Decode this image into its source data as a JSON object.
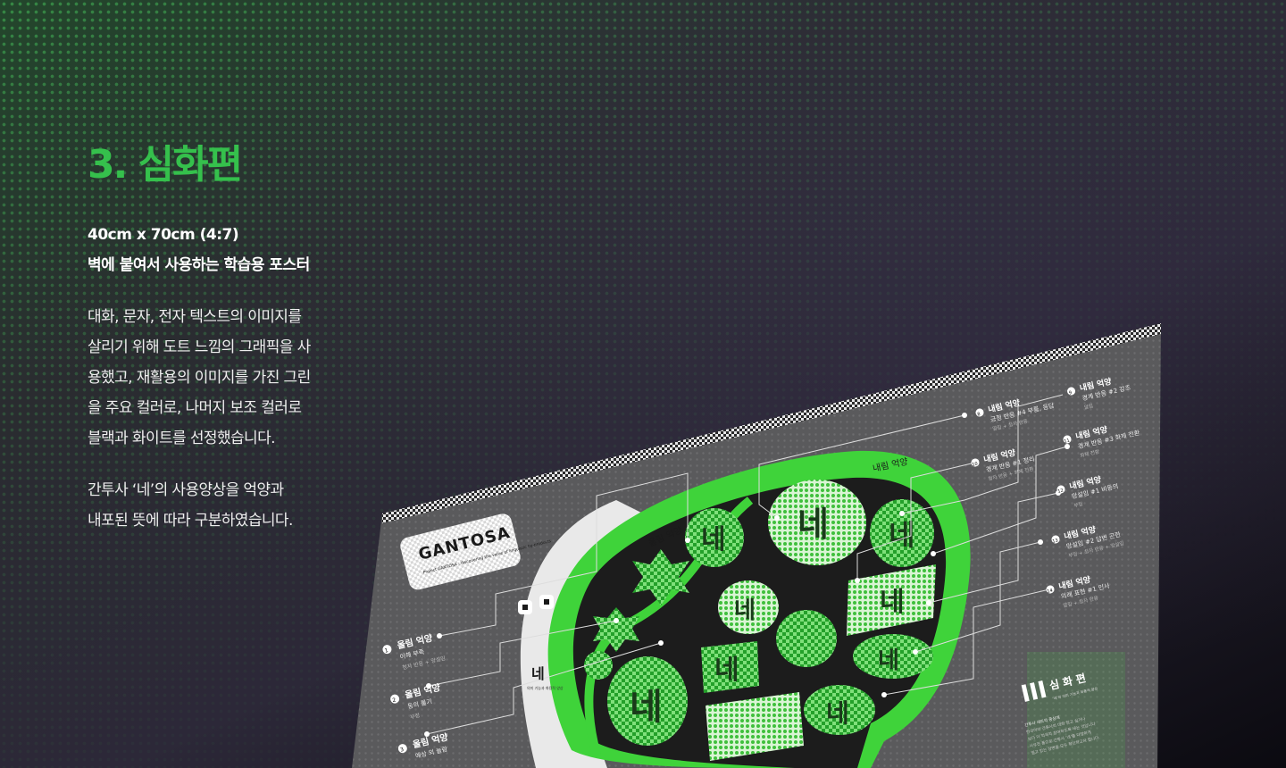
{
  "colors": {
    "accent": "#35c04c",
    "poster_bg": "#5a5a5c",
    "bubble": "#3fd33a",
    "text": "#ffffff"
  },
  "section": {
    "title": "3. 심화편"
  },
  "specs": {
    "size": "40cm x 70cm (4:7)",
    "purpose": "벽에 붙여서 사용하는 학습용 포스터"
  },
  "description": {
    "p1": [
      "대화, 문자, 전자 텍스트의 이미지를",
      "살리기 위해 도트 느낌의 그래픽을 사",
      "용했고, 재활용의 이미지를 가진 그린",
      "을 주요 컬러로, 나머지 보조 컬러로",
      "블랙과 화이트를 선정했습니다."
    ],
    "p2": [
      "간투사 ‘네’의 사용양상을 억양과",
      "내포된 뜻에 따라 구분하였습니다."
    ]
  },
  "poster": {
    "logo": "GANTOSA",
    "logo_sub": "Project GANTOSA : discovering the value of linguistic by-products",
    "center_char": "네",
    "center_sub": "의미 기능과 화용적 양상",
    "rising_label": "올림 억양",
    "falling_label": "내림 억양",
    "bubble_char": "네",
    "volume_mark": "III",
    "volume_title": "심 화 편",
    "volume_tags": "‘네’의 의미 기능과 화용적 양상",
    "left_items": [
      {
        "num": "1",
        "title": "올림 억양",
        "desc": "이해 부족",
        "sub": "청자 반응 + 망설임"
      },
      {
        "num": "2",
        "title": "올림 억양",
        "desc": "동의 물기",
        "sub": "부정"
      },
      {
        "num": "3",
        "title": "올림 억양",
        "desc": "예상 외 놀람",
        "sub": "놀람"
      }
    ],
    "right_items": [
      {
        "num": "9",
        "title": "내림 억양",
        "desc": "경계 반응 #2 강조",
        "sub": "말림"
      },
      {
        "num": "8",
        "title": "내림 억양",
        "desc": "긍정 반응 #4 부름, 응답",
        "sub": "말림 + 청자 반응"
      },
      {
        "num": "11",
        "title": "내림 억양",
        "desc": "경계 반응 #3 화제 전환",
        "sub": "화제 전환"
      },
      {
        "num": "10",
        "title": "내림 억양",
        "desc": "경계 반응 #1 정리",
        "sub": "청자 반응 + 화제 전환"
      },
      {
        "num": "12",
        "title": "내림 억양",
        "desc": "망설임 #1 비동의",
        "sub": "부정"
      },
      {
        "num": "13",
        "title": "내림 억양",
        "desc": "망설임 #2 답변 곤란",
        "sub": "부정 + 청자 반응 + 망설임"
      },
      {
        "num": "14",
        "title": "내림 억양",
        "desc": "의례 표현 #1 인사",
        "sub": "말림 + 청자 반응"
      }
    ],
    "footer_lines": [
      "간투사 세트의 중심에",
      "한국어의 간투사의 대화 참고 실거나",
      "보다 더 적극적 참여하도록 새는 것입니다",
      "사우전 풍으로 간투사 ‘네’를 다양하게",
      "일고 있는 장면을 모두 확인하고자 합니다."
    ]
  }
}
